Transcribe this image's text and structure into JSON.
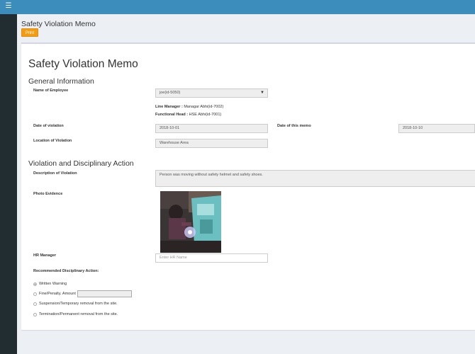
{
  "header": {
    "menu_icon": "hamburger-icon"
  },
  "page": {
    "title": "Safety Violation Memo",
    "print_label": "Print"
  },
  "memo": {
    "title": "Safety Violation Memo",
    "general_section": "General Information",
    "employee_label": "Name of Employee",
    "employee_value": "joe(id-5050)",
    "line_manager_label": "Line Manager :",
    "line_manager_value": "Managar Abhi(id-7002)",
    "functional_head_label": "Functional Head :",
    "functional_head_value": "HSE Abhi(id-7001)",
    "date_violation_label": "Date of violation",
    "date_violation_value": "2018-10-01",
    "date_memo_label": "Date of this memo",
    "date_memo_value": "2018-10-10",
    "location_label": "Location of Violation",
    "location_value": "Warehouse Area",
    "violation_section": "Violation and Disciplinary Action",
    "description_label": "Description of Violation",
    "description_value": "Person was moving without safety helmet and safety shoes.",
    "photo_label": "Photo Evidence",
    "hr_label": "HR Manager",
    "hr_placeholder": "Enter HR Name",
    "action_label": "Recommended Disciplinary Action:",
    "actions": [
      {
        "label": "Written Warning",
        "checked": true
      },
      {
        "label": "Fine/Penalty. Amount",
        "checked": false
      },
      {
        "label": "Suspension/Temporary removal from the site.",
        "checked": false
      },
      {
        "label": "Termination/Permanent removal from the site.",
        "checked": false
      }
    ]
  },
  "colors": {
    "topbar": "#3c8dbc",
    "sidebar": "#222d32",
    "print_button": "#f39c12"
  }
}
